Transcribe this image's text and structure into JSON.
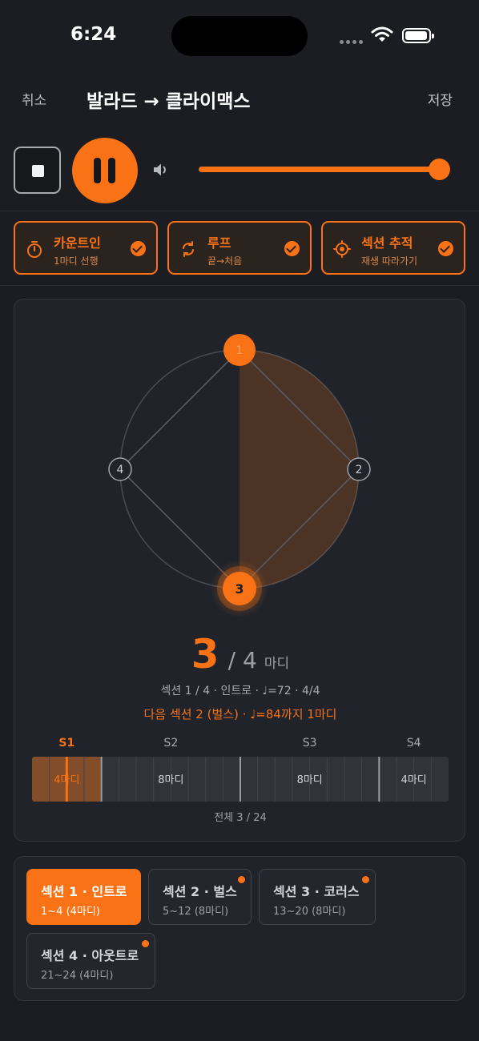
{
  "status": {
    "time": "6:24"
  },
  "nav": {
    "cancel": "취소",
    "title": "발라드 → 클라이맥스",
    "save": "저장"
  },
  "transport": {
    "volume": 0.95,
    "icons": [
      "stop-icon",
      "pause-icon",
      "speaker-icon"
    ]
  },
  "toggles": [
    {
      "title": "카운트인",
      "subtitle": "1마디 선행",
      "icon": "stopwatch-icon",
      "checked": true
    },
    {
      "title": "루프",
      "subtitle": "끝→처음",
      "icon": "loop-icon",
      "checked": true
    },
    {
      "title": "섹션 추적",
      "subtitle": "재생 따라가기",
      "icon": "crosshair-icon",
      "checked": true
    }
  ],
  "beat": {
    "labels": [
      "1",
      "2",
      "3",
      "4"
    ],
    "current": 3,
    "total": 4
  },
  "counter": {
    "current": "3",
    "sep": "/ 4",
    "unit": "마디"
  },
  "info_line": "섹션 1 / 4 · 인트로 · ♩=72 · 4/4",
  "next_line": "다음 섹션 2 (벌스) · ♩=84까지 1마디",
  "timeline": {
    "total_bars": 24,
    "current_bar": 3,
    "segments": [
      {
        "label": "S1",
        "bars": 4,
        "text": "4마디",
        "active": true
      },
      {
        "label": "S2",
        "bars": 8,
        "text": "8마디",
        "active": false
      },
      {
        "label": "S3",
        "bars": 8,
        "text": "8마디",
        "active": false
      },
      {
        "label": "S4",
        "bars": 4,
        "text": "4마디",
        "active": false
      }
    ]
  },
  "total_line": "전체 3 / 24",
  "sections": [
    {
      "title": "섹션 1 · 인트로",
      "range": "1~4 (4마디)",
      "active": true,
      "dot": false
    },
    {
      "title": "섹션 2 · 벌스",
      "range": "5~12 (8마디)",
      "active": false,
      "dot": true
    },
    {
      "title": "섹션 3 · 코러스",
      "range": "13~20 (8마디)",
      "active": false,
      "dot": true
    },
    {
      "title": "섹션 4 · 아웃트로",
      "range": "21~24 (4마디)",
      "active": false,
      "dot": true
    }
  ],
  "colors": {
    "accent": "#f97316",
    "background": "#1b1d22",
    "card": "#20232a"
  }
}
